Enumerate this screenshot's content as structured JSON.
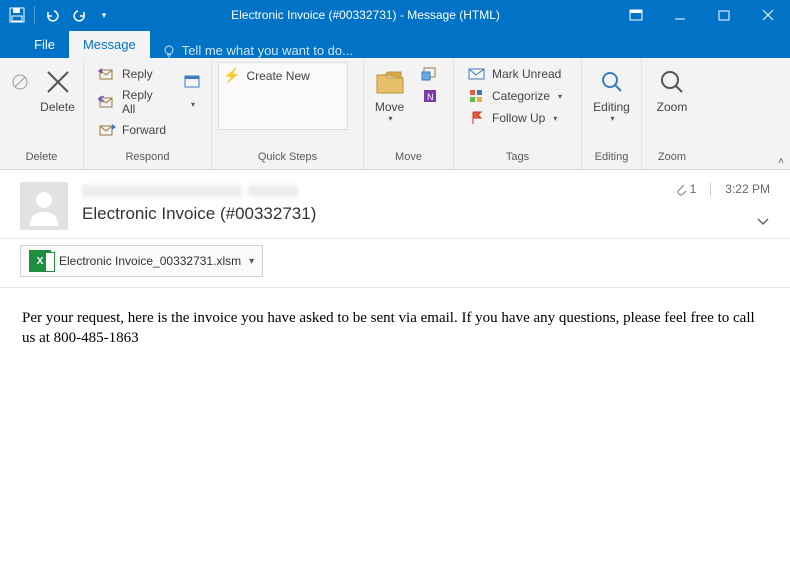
{
  "window": {
    "title": "Electronic Invoice (#00332731) - Message (HTML)"
  },
  "tabs": {
    "file": "File",
    "message": "Message",
    "tell_me": "Tell me what you want to do..."
  },
  "ribbon": {
    "delete_group": {
      "label": "Delete",
      "delete": "Delete"
    },
    "respond_group": {
      "label": "Respond",
      "reply": "Reply",
      "reply_all": "Reply All",
      "forward": "Forward"
    },
    "quicksteps_group": {
      "label": "Quick Steps",
      "create_new": "Create New"
    },
    "move_group": {
      "label": "Move",
      "move": "Move"
    },
    "tags_group": {
      "label": "Tags",
      "mark_unread": "Mark Unread",
      "categorize": "Categorize",
      "follow_up": "Follow Up"
    },
    "editing_group": {
      "label": "Editing",
      "editing": "Editing"
    },
    "zoom_group": {
      "label": "Zoom",
      "zoom": "Zoom"
    }
  },
  "message": {
    "subject": "Electronic Invoice (#00332731)",
    "time": "3:22 PM",
    "attachment_count": "1",
    "attachment_name": "Electronic Invoice_00332731.xlsm",
    "body": "Per your request, here is the invoice you have asked to be sent via email. If you have any questions, please feel free to call us at 800-485-1863"
  }
}
